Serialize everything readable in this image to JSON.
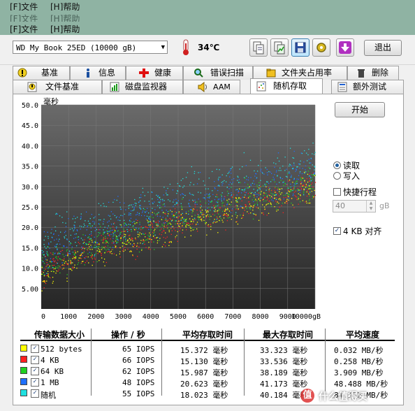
{
  "menus": [
    {
      "file": "[F]文件",
      "help": "[H]帮助"
    },
    {
      "file": "[F]文件",
      "help": "[H]帮助"
    },
    {
      "file": "[F]文件",
      "help": "[H]帮助"
    }
  ],
  "toolbar": {
    "drive": "WD      My Book 25ED   (10000 gB)",
    "temperature": "34℃",
    "exit_label": "退出",
    "icons": [
      "copy-text-icon",
      "copy-graph-icon",
      "save-icon",
      "options-icon",
      "download-icon"
    ]
  },
  "tabs_row1": [
    "基准",
    "信息",
    "健康",
    "错误扫描",
    "文件夹占用率",
    "删除"
  ],
  "tabs_row2": [
    "文件基准",
    "磁盘监视器",
    "AAM",
    "随机存取",
    "额外测试"
  ],
  "selected_tab": "随机存取",
  "controls": {
    "start_label": "开始",
    "read_label": "读取",
    "write_label": "写入",
    "read_selected": true,
    "short_stroke_label": "快捷行程",
    "short_stroke_checked": false,
    "short_stroke_value": "40",
    "short_stroke_unit": "gB",
    "align_label": "4 KB 对齐",
    "align_checked": true
  },
  "chart_data": {
    "type": "scatter",
    "ylabel": "毫秒",
    "xlabel": "",
    "xlim": [
      0,
      10000
    ],
    "ylim": [
      0,
      50
    ],
    "x_ticks": [
      "0",
      "1000",
      "2000",
      "3000",
      "4000",
      "5000",
      "6000",
      "7000",
      "8000",
      "9000",
      "10000gB"
    ],
    "y_ticks": [
      "5.00",
      "10.0",
      "15.0",
      "20.0",
      "25.0",
      "30.0",
      "35.0",
      "40.0",
      "45.0",
      "50.0"
    ],
    "grid": true,
    "series": [
      {
        "color": "#ffff00",
        "trend": [
          [
            0,
            8
          ],
          [
            10000,
            30
          ]
        ],
        "spread": 3.2
      },
      {
        "color": "#ff2020",
        "trend": [
          [
            0,
            9
          ],
          [
            10000,
            30
          ]
        ],
        "spread": 3.4
      },
      {
        "color": "#20d020",
        "trend": [
          [
            0,
            10
          ],
          [
            10000,
            31
          ]
        ],
        "spread": 3.5
      },
      {
        "color": "#2070ff",
        "trend": [
          [
            0,
            14
          ],
          [
            10000,
            34
          ]
        ],
        "spread": 4.5
      },
      {
        "color": "#20e0e0",
        "trend": [
          [
            0,
            15
          ],
          [
            10000,
            35
          ]
        ],
        "spread": 5
      }
    ]
  },
  "table": {
    "headers": [
      "传输数据大小",
      "操作 / 秒",
      "平均存取时间",
      "最大存取时间",
      "平均速度"
    ],
    "rows": [
      {
        "color": "#ffff00",
        "label": "512 bytes",
        "ops": "65 IOPS",
        "avg": "15.372 毫秒",
        "max": "33.323 毫秒",
        "speed": "0.032 MB/秒"
      },
      {
        "color": "#ff2020",
        "label": "4 KB",
        "ops": "66 IOPS",
        "avg": "15.130 毫秒",
        "max": "33.536 毫秒",
        "speed": "0.258 MB/秒"
      },
      {
        "color": "#20d020",
        "label": "64 KB",
        "ops": "62 IOPS",
        "avg": "15.987 毫秒",
        "max": "38.189 毫秒",
        "speed": "3.909 MB/秒"
      },
      {
        "color": "#2070ff",
        "label": "1 MB",
        "ops": "48 IOPS",
        "avg": "20.623 毫秒",
        "max": "41.173 毫秒",
        "speed": "48.488 MB/秒"
      },
      {
        "color": "#20e0e0",
        "label": "随机",
        "ops": "55 IOPS",
        "avg": "18.023 毫秒",
        "max": "40.184 毫秒",
        "speed": "84.152 MB/秒"
      }
    ]
  },
  "watermark": {
    "text": "什么值得买",
    "logo": "值"
  }
}
